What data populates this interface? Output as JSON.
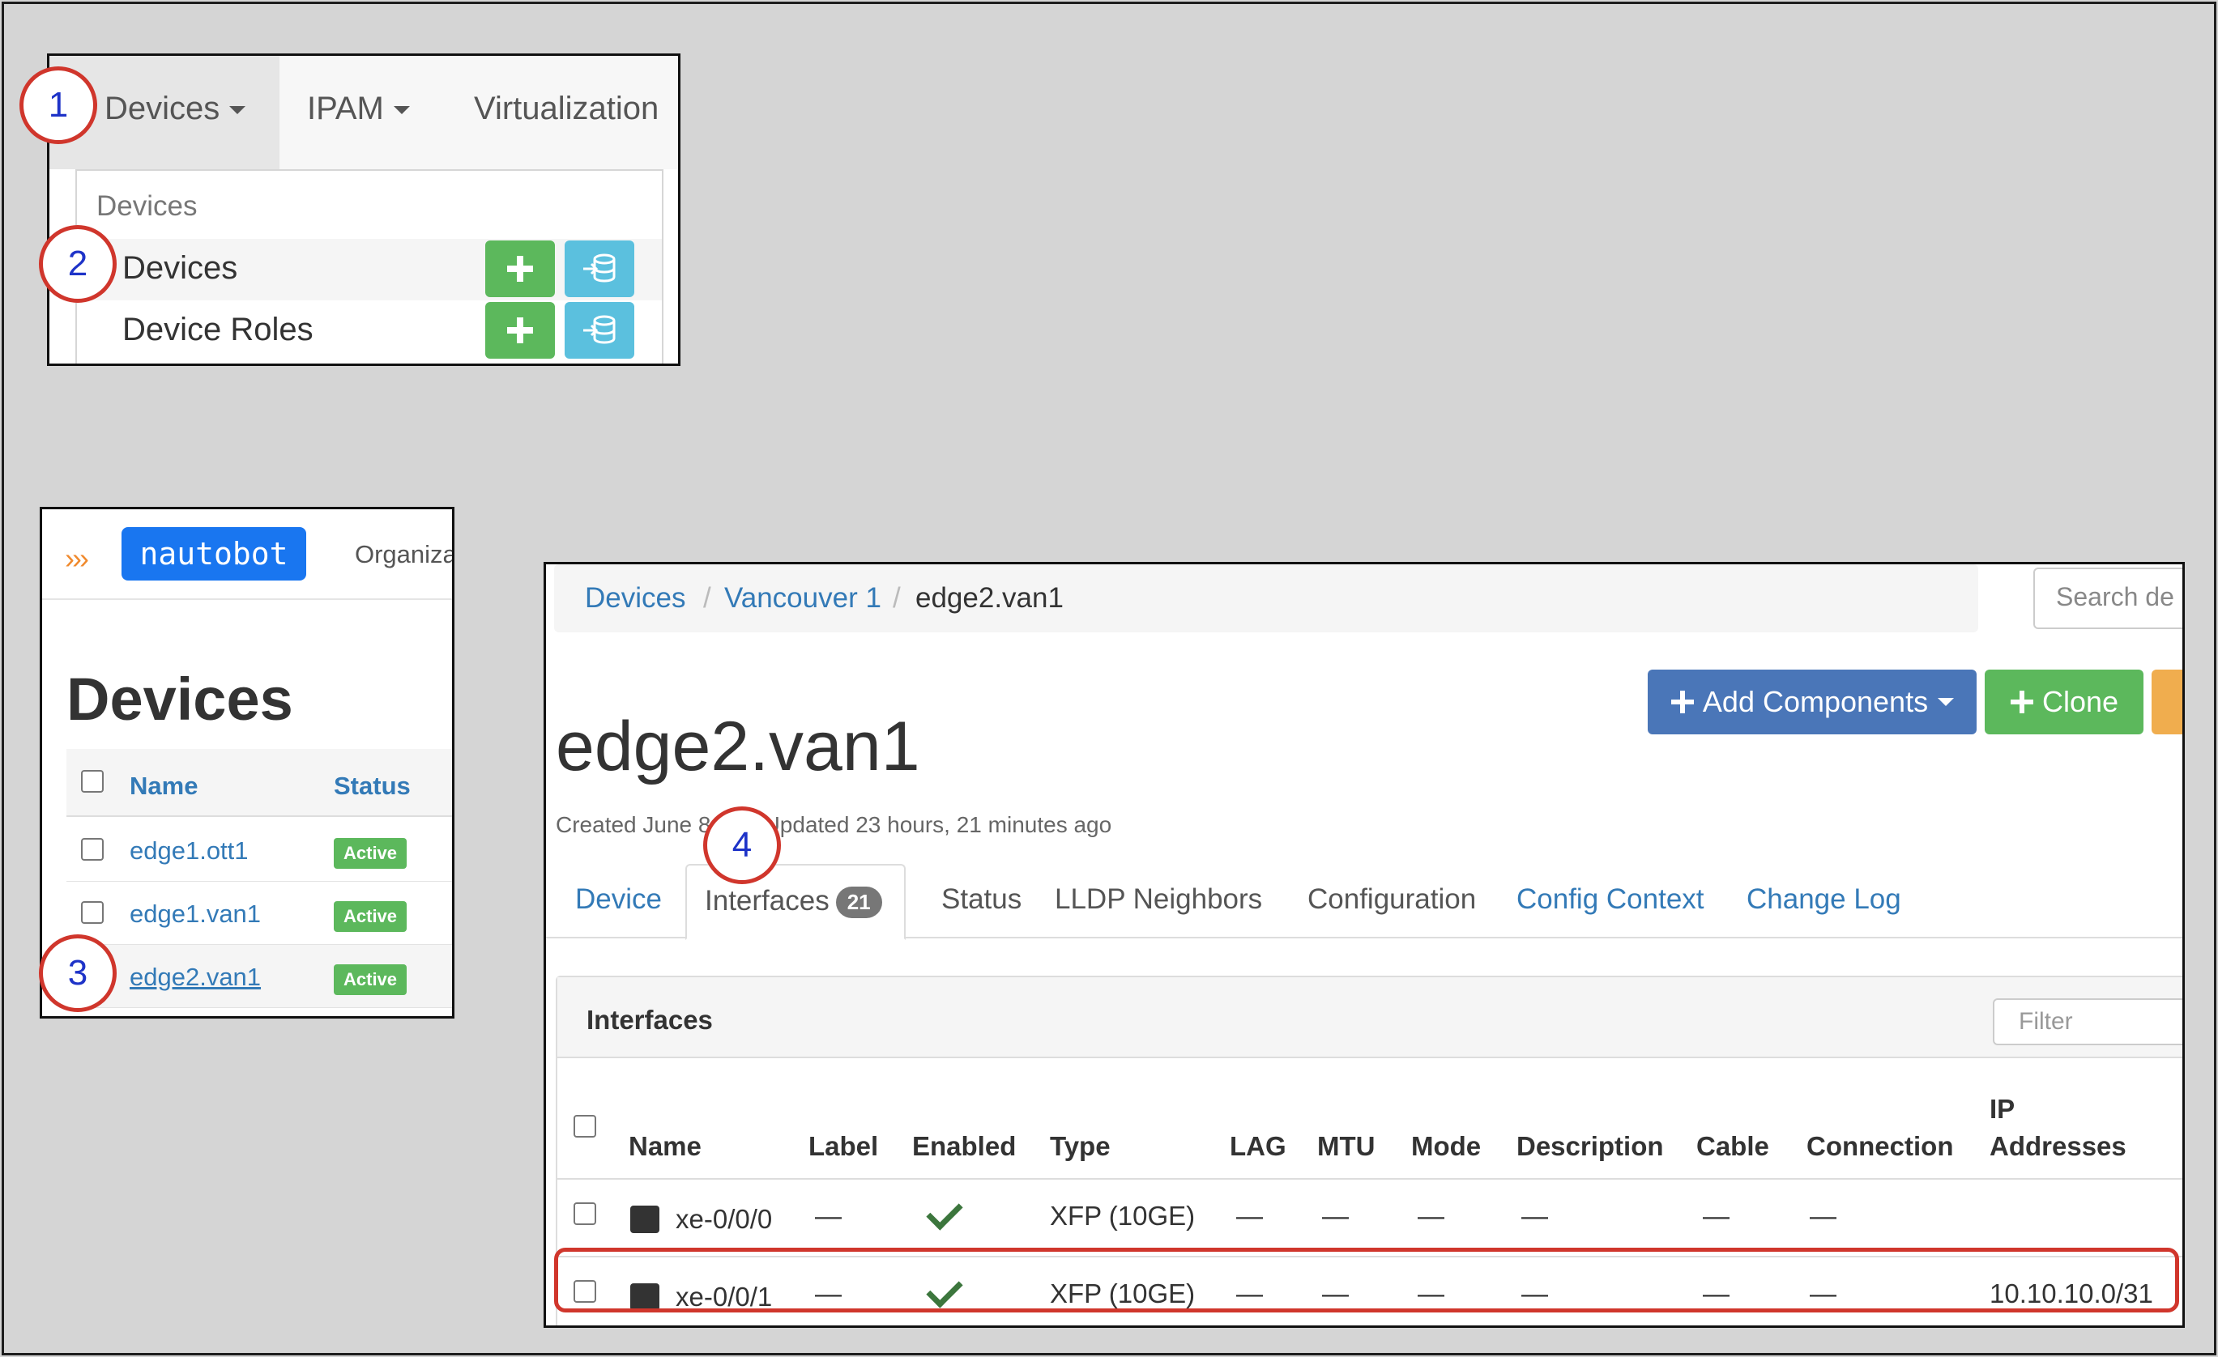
{
  "markers": [
    "1",
    "2",
    "3",
    "4"
  ],
  "panel1": {
    "nav": [
      "Devices",
      "IPAM",
      "Virtualization"
    ],
    "menu_header": "Devices",
    "menu_items": [
      "Devices",
      "Device Roles"
    ]
  },
  "panel2": {
    "logo": "nautobot",
    "nav_partial": "Organiza",
    "heading": "Devices",
    "columns": [
      "Name",
      "Status"
    ],
    "rows": [
      {
        "name": "edge1.ott1",
        "status": "Active"
      },
      {
        "name": "edge1.van1",
        "status": "Active"
      },
      {
        "name": "edge2.van1",
        "status": "Active"
      }
    ]
  },
  "panel3": {
    "breadcrumb": [
      "Devices",
      "Vancouver 1",
      "edge2.van1"
    ],
    "search_placeholder": "Search de",
    "buttons": {
      "add_components": "Add Components",
      "clone": "Clone"
    },
    "title": "edge2.van1",
    "meta_left": "Created June 8",
    "meta_right": "· Updated 23 hours, 21 minutes ago",
    "tabs": [
      "Device",
      "Interfaces",
      "Status",
      "LLDP Neighbors",
      "Configuration",
      "Config Context",
      "Change Log"
    ],
    "interfaces_count": "21",
    "card_title": "Interfaces",
    "filter_placeholder": "Filter",
    "columns": [
      "Name",
      "Label",
      "Enabled",
      "Type",
      "LAG",
      "MTU",
      "Mode",
      "Description",
      "Cable",
      "Connection",
      "IP",
      "Addresses"
    ],
    "rows": [
      {
        "name": "xe-0/0/0",
        "label": "—",
        "type": "XFP (10GE)",
        "lag": "—",
        "mtu": "—",
        "mode": "—",
        "description": "—",
        "cable": "—",
        "connection": "—",
        "ip": ""
      },
      {
        "name": "xe-0/0/1",
        "label": "—",
        "type": "XFP (10GE)",
        "lag": "—",
        "mtu": "—",
        "mode": "—",
        "description": "—",
        "cable": "—",
        "connection": "—",
        "ip": "10.10.10.0/31"
      }
    ]
  },
  "colors": {
    "annotation_red": "#d0362c",
    "marker_blue": "#1e33c8",
    "link_blue": "#337ab7",
    "success_green": "#5cb85c",
    "primary_blue": "#4a76b8"
  }
}
